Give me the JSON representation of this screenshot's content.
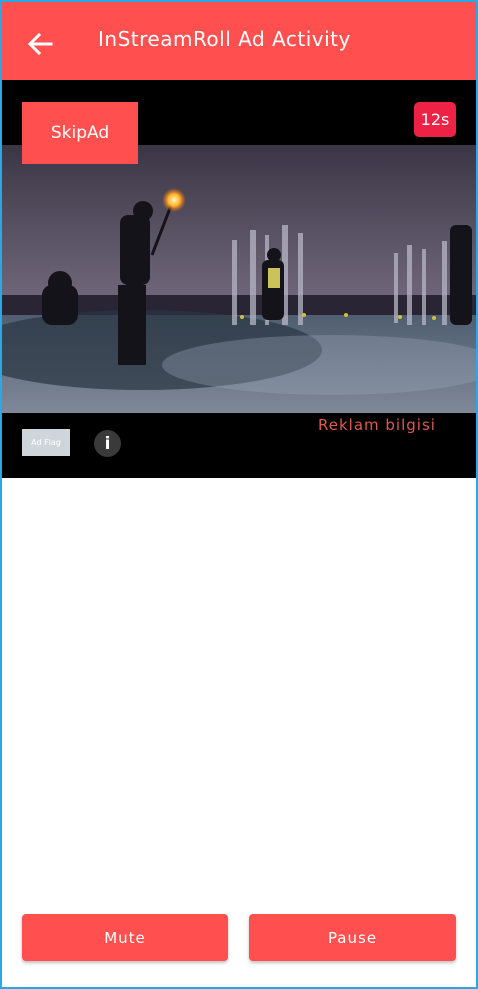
{
  "appbar": {
    "title": "InStreamRoll Ad Activity",
    "back_icon": "arrow-left-icon"
  },
  "player": {
    "skip_label": "SkipAd",
    "countdown": "12s",
    "ad_flag_label": "Ad Flag",
    "info_symbol": "i",
    "ad_info_link": "Reklam bilgisi"
  },
  "controls": {
    "mute_label": "Mute",
    "pause_label": "Pause"
  },
  "colors": {
    "accent": "#ff4f4f",
    "timer": "#ee2244",
    "reklam_text": "#e05a4d"
  }
}
